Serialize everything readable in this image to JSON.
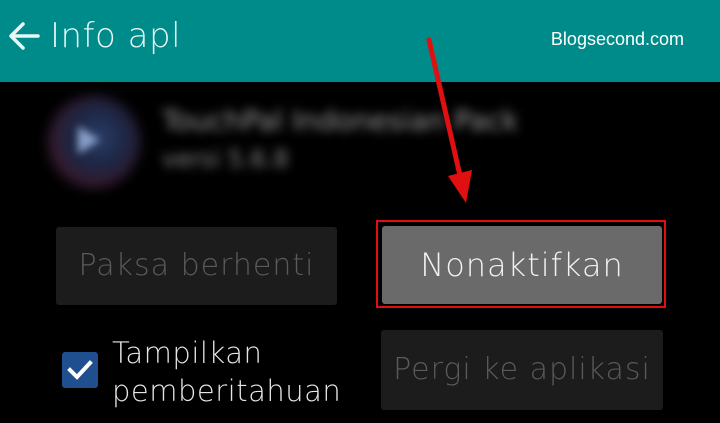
{
  "header": {
    "title": "Info apl",
    "watermark": "Blogsecond.com",
    "back_icon": "arrow-left-icon",
    "color": "#008b8b"
  },
  "app": {
    "name": "TouchPal Indonesian Pack",
    "version": "versi 5.6.8",
    "icon": "app-icon"
  },
  "buttons": {
    "force_stop": "Paksa berhenti",
    "disable": "Nonaktifkan",
    "go_to_app": "Pergi ke aplikasi"
  },
  "notifications": {
    "label_line1": "Tampilkan",
    "label_line2": "pemberitahuan",
    "checked": true
  },
  "annotation": {
    "color": "#e01010"
  }
}
